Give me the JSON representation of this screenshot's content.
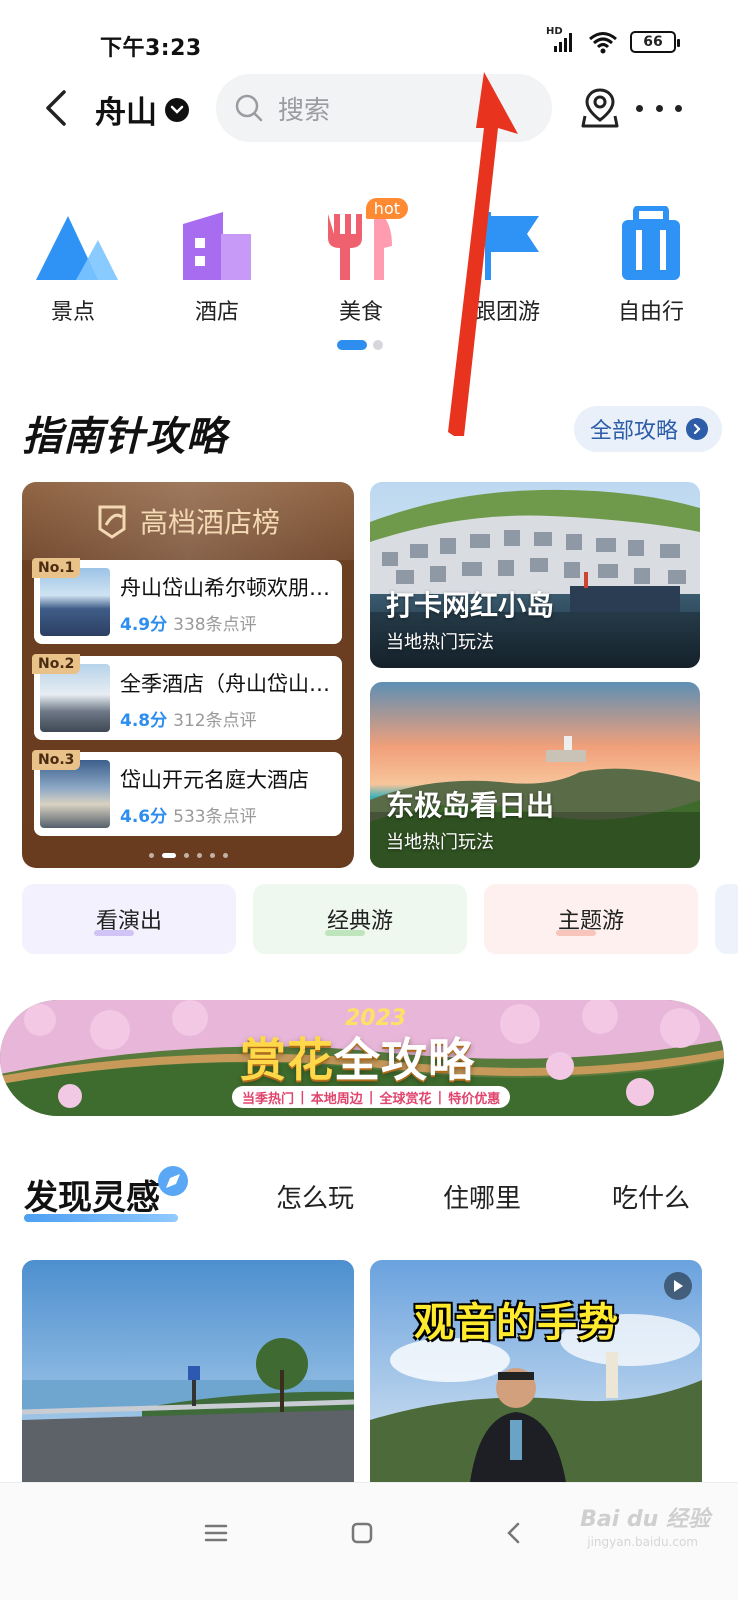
{
  "status": {
    "time": "下午3:23",
    "network": "HD",
    "battery": "66"
  },
  "nav": {
    "city": "舟山",
    "search_placeholder": "搜索"
  },
  "categories": [
    {
      "label": "景点",
      "icon": "mountain-icon"
    },
    {
      "label": "酒店",
      "icon": "building-icon"
    },
    {
      "label": "美食",
      "icon": "fork-knife-icon",
      "badge": "hot"
    },
    {
      "label": "跟团游",
      "icon": "flag-icon"
    },
    {
      "label": "自由行",
      "icon": "luggage-icon"
    }
  ],
  "guide": {
    "title": "指南针攻略",
    "all_label": "全部攻略",
    "hotel_list": {
      "title": "高档酒店榜",
      "items": [
        {
          "rank": "No.1",
          "name": "舟山岱山希尔顿欢朋酒店",
          "score": "4.9分",
          "reviews": "338条点评"
        },
        {
          "rank": "No.2",
          "name": "全季酒店（舟山岱山店）",
          "score": "4.8分",
          "reviews": "312条点评"
        },
        {
          "rank": "No.3",
          "name": "岱山开元名庭大酒店",
          "score": "4.6分",
          "reviews": "533条点评"
        }
      ]
    },
    "cards": [
      {
        "title": "打卡网红小岛",
        "subtitle": "当地热门玩法"
      },
      {
        "title": "东极岛看日出",
        "subtitle": "当地热门玩法"
      }
    ]
  },
  "pills": [
    "看演出",
    "经典游",
    "主题游"
  ],
  "banner": {
    "year": "2023",
    "title_a": "赏花",
    "title_b": "全攻略",
    "tags": [
      "当季热门",
      "本地周边",
      "全球赏花",
      "特价优惠"
    ]
  },
  "discover": {
    "active_tab": "发现灵感",
    "tabs": [
      "怎么玩",
      "住哪里",
      "吃什么"
    ]
  },
  "feed": [
    {
      "type": "photo"
    },
    {
      "type": "video",
      "title": "观音的手势"
    }
  ],
  "watermark": {
    "brand": "Bai du 经验",
    "url": "jingyan.baidu.com"
  },
  "colors": {
    "accent": "#2d8ef0",
    "arrow": "#e8331f",
    "hotel_bg": "#6a3c1f"
  }
}
